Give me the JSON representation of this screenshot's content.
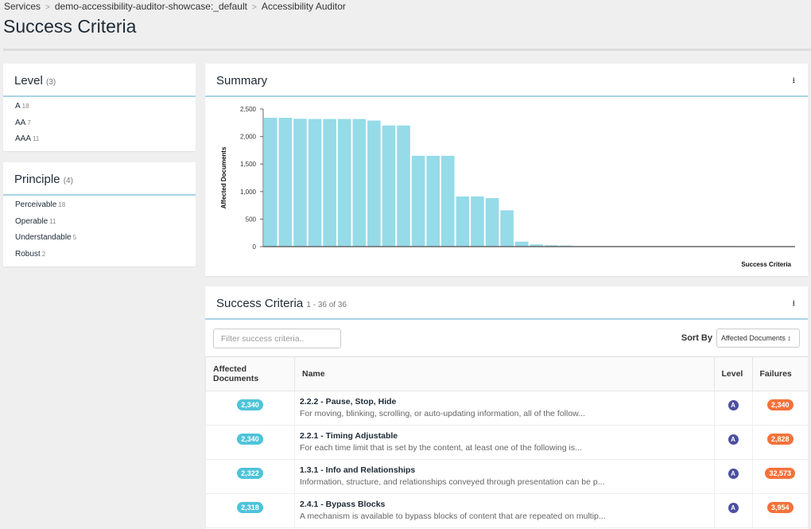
{
  "breadcrumb": [
    "Services",
    "demo-accessibility-auditor-showcase:_default",
    "Accessibility Auditor"
  ],
  "page_title": "Success Criteria",
  "level_panel": {
    "title": "Level",
    "count": "(3)",
    "items": [
      {
        "label": "A",
        "count": "18"
      },
      {
        "label": "AA",
        "count": "7"
      },
      {
        "label": "AAA",
        "count": "11"
      }
    ]
  },
  "principle_panel": {
    "title": "Principle",
    "count": "(4)",
    "items": [
      {
        "label": "Perceivable",
        "count": "18"
      },
      {
        "label": "Operable",
        "count": "11"
      },
      {
        "label": "Understandable",
        "count": "5"
      },
      {
        "label": "Robust",
        "count": "2"
      }
    ]
  },
  "summary": {
    "title": "Summary",
    "download_icon": "download-icon"
  },
  "chart_data": {
    "type": "bar",
    "xlabel": "Success Criteria",
    "ylabel": "Affected Documents",
    "ylim": [
      0,
      2500
    ],
    "yticks": [
      "0",
      "500",
      "1,000",
      "1,500",
      "2,000",
      "2,500"
    ],
    "color": "#95dbe8",
    "values": [
      2340,
      2340,
      2322,
      2318,
      2318,
      2318,
      2318,
      2290,
      2200,
      2200,
      1650,
      1650,
      1650,
      910,
      910,
      880,
      660,
      90,
      40,
      25,
      20,
      8,
      8,
      8,
      8,
      8,
      8,
      8,
      8,
      8,
      8,
      8,
      5,
      5,
      5,
      5
    ]
  },
  "criteria": {
    "title": "Success Criteria",
    "range": "1 - 36 of 36",
    "filter_placeholder": "Filter success criteria..",
    "sort_label": "Sort By",
    "sort_value": "Affected Documents",
    "columns": [
      "Affected Documents",
      "Name",
      "Level",
      "Failures"
    ],
    "rows": [
      {
        "docs": "2,340",
        "name": "2.2.2 - Pause, Stop, Hide",
        "desc": "For moving, blinking, scrolling, or auto-updating information, all of the follow...",
        "level": "A",
        "failures": "2,340"
      },
      {
        "docs": "2,340",
        "name": "2.2.1 - Timing Adjustable",
        "desc": "For each time limit that is set by the content, at least one of the following is...",
        "level": "A",
        "failures": "2,828"
      },
      {
        "docs": "2,322",
        "name": "1.3.1 - Info and Relationships",
        "desc": "Information, structure, and relationships conveyed through presentation can be p...",
        "level": "A",
        "failures": "32,573"
      },
      {
        "docs": "2,318",
        "name": "2.4.1 - Bypass Blocks",
        "desc": "A mechanism is available to bypass blocks of content that are repeated on multip...",
        "level": "A",
        "failures": "3,954"
      }
    ]
  }
}
